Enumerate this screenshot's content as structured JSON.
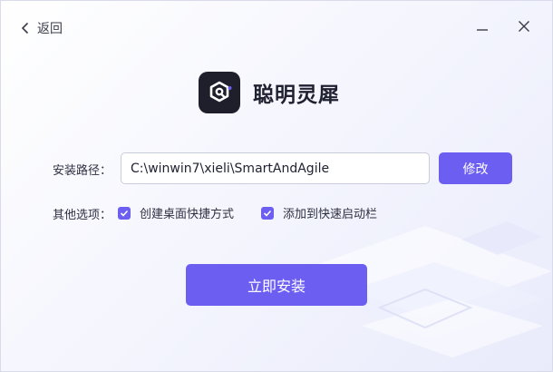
{
  "header": {
    "back_label": "返回",
    "back_icon": "chevron-left-icon",
    "minimize_icon": "minimize-icon",
    "close_icon": "close-icon"
  },
  "brand": {
    "name": "聪明灵犀",
    "logo_icon": "app-logo-icon"
  },
  "install_path": {
    "label": "安装路径：",
    "value": "C:\\winwin7\\xieli\\SmartAndAgile",
    "modify_label": "修改"
  },
  "options": {
    "label": "其他选项：",
    "items": [
      {
        "label": "创建桌面快捷方式",
        "checked": true
      },
      {
        "label": "添加到快速启动栏",
        "checked": true
      }
    ]
  },
  "install_button_label": "立即安装",
  "colors": {
    "accent": "#6d5ef2",
    "logo_bg": "#1e1f2b",
    "text": "#1f2030"
  }
}
